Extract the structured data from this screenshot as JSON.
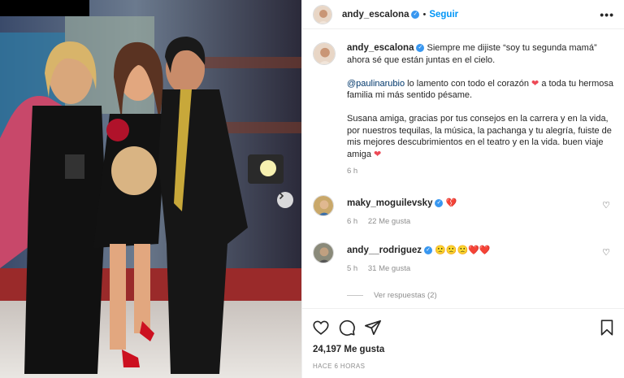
{
  "post": {
    "username": "andy_escalona",
    "follow_label": "Seguir",
    "more_icon": "more-options-icon",
    "next_icon": "chevron-right-icon"
  },
  "caption": {
    "username": "andy_escalona",
    "line1": "Siempre me dijiste “soy tu segunda mamá” ahora sé que están juntas en el cielo.",
    "mention": "@paulinarubio",
    "line2a": " lo lamento con todo el corazón ",
    "line2b": " a toda tu hermosa familia mi más sentido pésame.",
    "line3": "Susana amiga, gracias por tus consejos en la carrera y en la vida, por nuestros tequilas, la música, la pachanga y tu alegría, fuiste de mis mejores descubrimientos en el teatro y en la vida. buen viaje amiga ",
    "time": "6 h"
  },
  "comments": [
    {
      "username": "maky_moguilevsky",
      "emoji": "💔",
      "time": "6 h",
      "likes": "22 Me gusta"
    },
    {
      "username": "andy__rodriguez",
      "emoji": "🙁🙁🙁❤️❤️",
      "time": "5 h",
      "likes": "31 Me gusta"
    }
  ],
  "view_replies": "Ver respuestas (2)",
  "footer": {
    "likes": "24,197 Me gusta",
    "timestamp": "HACE 6 HORAS"
  },
  "colors": {
    "link": "#0095f6",
    "heart": "#ed4956",
    "muted": "#8e8e8e"
  }
}
